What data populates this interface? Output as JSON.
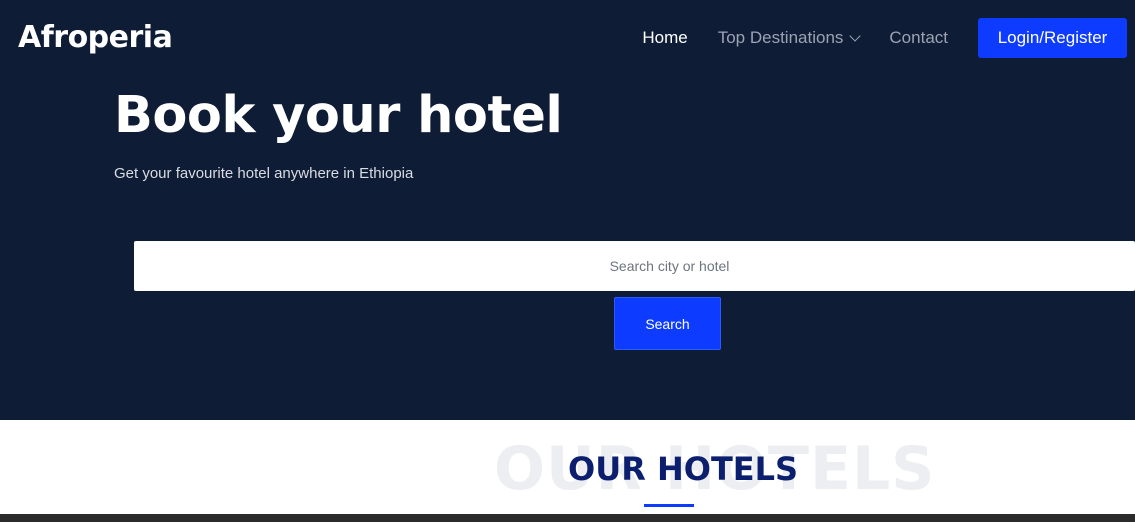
{
  "brand": "Afroperia",
  "nav": {
    "home": "Home",
    "destinations": "Top Destinations",
    "contact": "Contact",
    "login": "Login/Register"
  },
  "hero": {
    "title": "Book your hotel",
    "subtitle": "Get your favourite hotel anywhere in Ethiopia"
  },
  "search": {
    "placeholder": "Search city or hotel",
    "button": "Search"
  },
  "section": {
    "background_text": "OUR HOTELS",
    "title": "OUR HOTELS"
  },
  "colors": {
    "hero_bg": "#0f1c35",
    "accent": "#0d3bff",
    "section_title": "#0c1f6e"
  }
}
